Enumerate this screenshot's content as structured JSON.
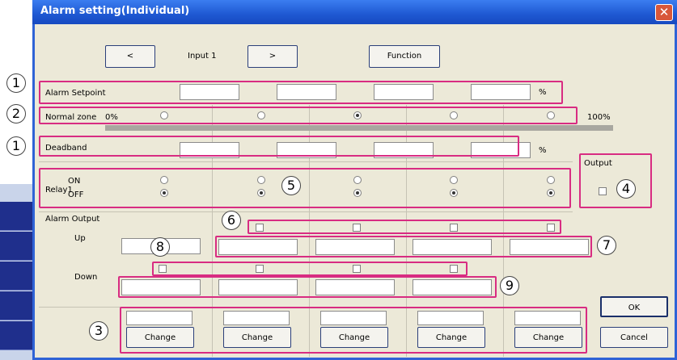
{
  "window": {
    "title": "Alarm setting(Individual)",
    "close_symbol": "✕"
  },
  "nav": {
    "prev_label": "<",
    "input_label": "Input 1",
    "next_label": ">",
    "function_label": "Function"
  },
  "rows": {
    "alarm_setpoint": "Alarm Setpoint",
    "setpoint_unit": "%",
    "normal_zone": "Normal zone",
    "zone_start": "0%",
    "zone_end": "100%",
    "normal_zone_selected_index": 2,
    "deadband": "Deadband",
    "deadband_unit": "%",
    "relay": "Relay1",
    "relay_on": "ON",
    "relay_off": "OFF",
    "relay_state": [
      "OFF",
      "OFF",
      "OFF",
      "OFF",
      "OFF"
    ],
    "output": "Output",
    "alarm_output": "Alarm Output",
    "up": "Up",
    "down": "Down"
  },
  "buttons": {
    "change_label": "Change",
    "ok_label": "OK",
    "cancel_label": "Cancel"
  },
  "markers": [
    "1",
    "2",
    "1",
    "5",
    "4",
    "6",
    "8",
    "7",
    "9",
    "3"
  ],
  "colors": {
    "annotation": "#d82c82",
    "titlebar": "#1e58d2",
    "dialog_bg": "#ece9d8"
  },
  "icons": {
    "close": "close-icon"
  }
}
